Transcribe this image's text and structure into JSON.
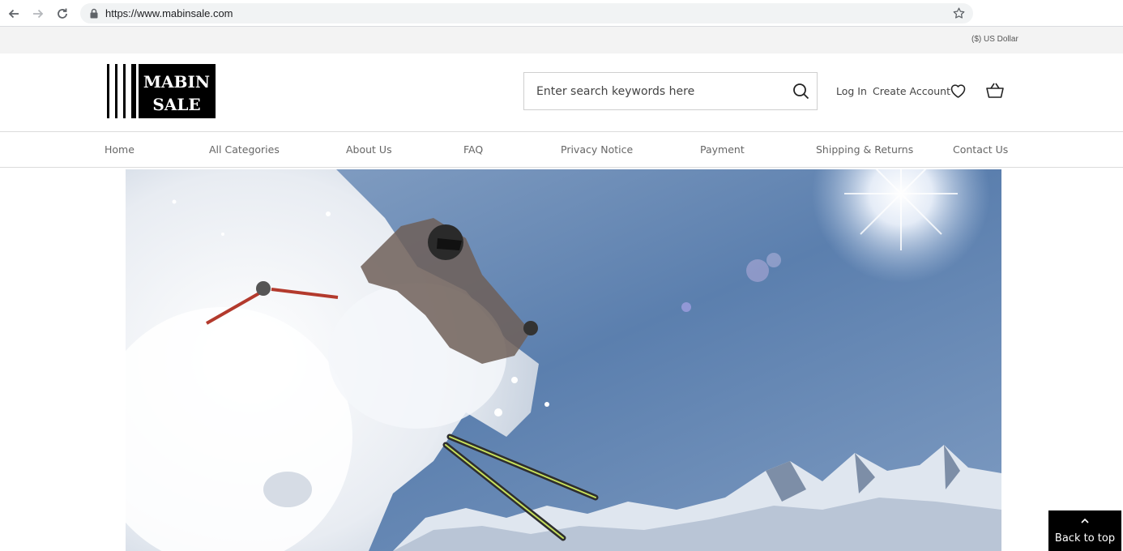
{
  "browser": {
    "url": "https://www.mabinsale.com"
  },
  "top_bar": {
    "currency": "($) US Dollar"
  },
  "header": {
    "logo_line1": "MABIN",
    "logo_line2": "SALE",
    "search_placeholder": "Enter search keywords here",
    "login_label": "Log In",
    "create_account_label": "Create Account"
  },
  "nav": {
    "items": [
      {
        "label": "Home"
      },
      {
        "label": "All Categories"
      },
      {
        "label": "About Us"
      },
      {
        "label": "FAQ"
      },
      {
        "label": "Privacy Notice"
      },
      {
        "label": "Payment"
      },
      {
        "label": "Shipping & Returns"
      },
      {
        "label": "Contact Us"
      }
    ]
  },
  "back_to_top": {
    "label": "Back to top"
  },
  "colors": {
    "accent": "#000000",
    "sky": "#5b7fae",
    "nav_text": "#666666"
  }
}
